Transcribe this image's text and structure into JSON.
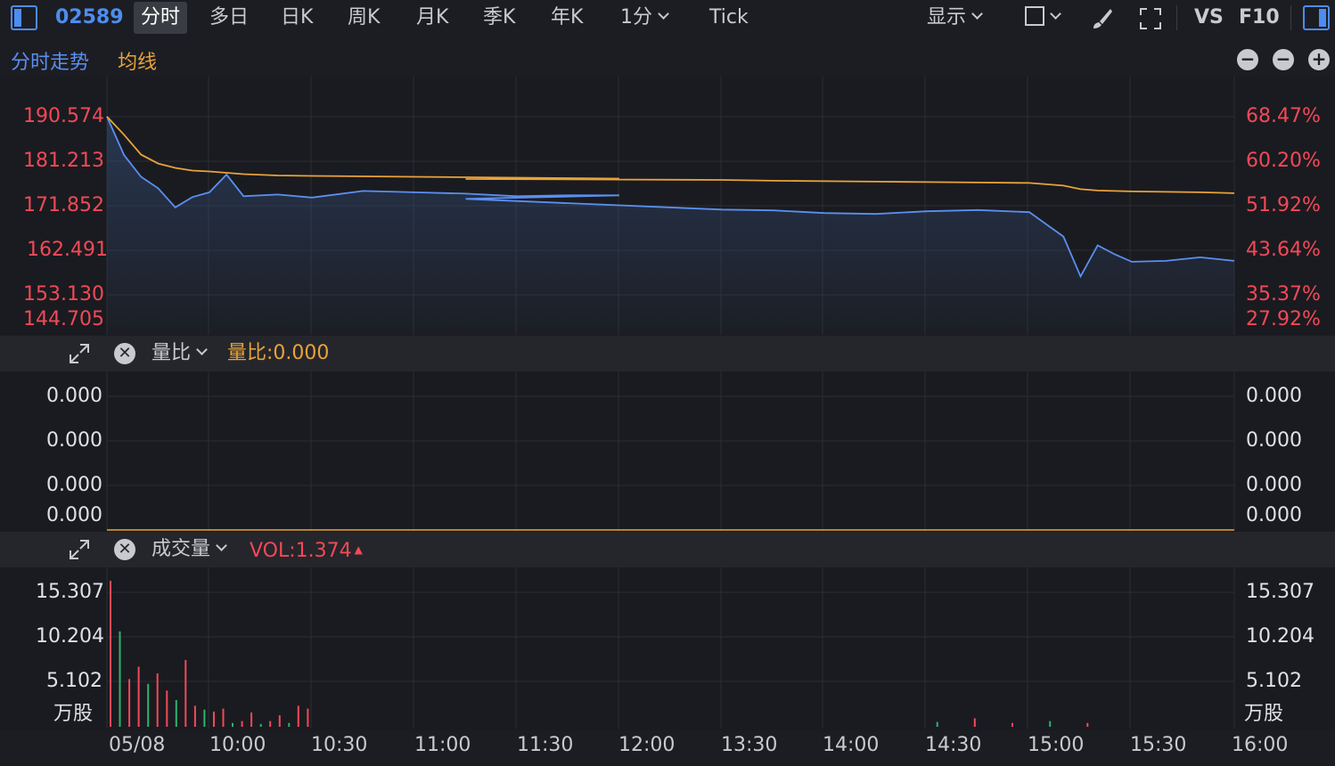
{
  "toolbar": {
    "code": "02589",
    "tabs": [
      "分时",
      "多日",
      "日K",
      "周K",
      "月K",
      "季K",
      "年K"
    ],
    "period": "1分",
    "tick": "Tick",
    "display": "显示",
    "vs": "VS",
    "f10": "F10"
  },
  "legend": {
    "series1": "分时走势",
    "series2": "均线",
    "color_price": "#5b8ff0",
    "color_avg": "#e8a33a"
  },
  "price_panel": {
    "left_labels": [
      "190.574",
      "181.213",
      "171.852",
      "162.491",
      "153.130",
      "144.705"
    ],
    "right_labels": [
      "68.47%",
      "60.20%",
      "51.92%",
      "43.64%",
      "35.37%",
      "27.92%"
    ],
    "up_color": "#f24957"
  },
  "ratio_panel": {
    "title": "量比",
    "value_text": "量比:0.000",
    "left_labels": [
      "0.000",
      "0.000",
      "0.000",
      "0.000"
    ],
    "right_labels": [
      "0.000",
      "0.000",
      "0.000",
      "0.000"
    ]
  },
  "volume_panel": {
    "title": "成交量",
    "value_text": "VOL:1.374",
    "left_labels": [
      "15.307",
      "10.204",
      "5.102",
      "万股"
    ],
    "right_labels": [
      "15.307",
      "10.204",
      "5.102",
      "万股"
    ]
  },
  "x_labels": [
    "05/08",
    "10:00",
    "10:30",
    "11:00",
    "11:30",
    "12:00",
    "13:30",
    "14:00",
    "14:30",
    "15:00",
    "15:30",
    "16:00"
  ],
  "chart_data": {
    "type": "line",
    "x": [
      "09:30",
      "09:35",
      "09:40",
      "09:45",
      "09:50",
      "09:55",
      "10:00",
      "10:05",
      "10:10",
      "10:20",
      "10:30",
      "10:45",
      "11:00",
      "11:15",
      "11:30",
      "11:45",
      "12:00",
      "12:15",
      "13:30",
      "13:45",
      "14:00",
      "14:15",
      "14:30",
      "14:45",
      "15:00",
      "15:10",
      "15:15",
      "15:20",
      "15:25",
      "15:30",
      "15:40",
      "15:50",
      "16:00"
    ],
    "series": [
      {
        "name": "分时走势",
        "values": [
          190.6,
          181.9,
          177.0,
          174.4,
          170.1,
          172.4,
          173.5,
          177.5,
          172.6,
          173.0,
          172.3,
          173.8,
          173.5,
          173.2,
          172.6,
          172.8,
          172.8,
          172.0,
          169.6,
          169.4,
          168.8,
          168.6,
          169.2,
          169.5,
          169.0,
          163.5,
          154.5,
          161.5,
          159.5,
          157.8,
          158.0,
          158.8,
          158.0
        ]
      },
      {
        "name": "均线",
        "values": [
          190.6,
          186.5,
          182.0,
          180.0,
          179.0,
          178.4,
          178.2,
          177.9,
          177.6,
          177.3,
          177.2,
          177.1,
          177.0,
          176.9,
          176.8,
          176.7,
          176.6,
          176.5,
          176.3,
          176.1,
          176.0,
          175.9,
          175.8,
          175.7,
          175.6,
          175.0,
          174.2,
          173.9,
          173.8,
          173.7,
          173.6,
          173.5,
          173.3
        ]
      }
    ],
    "ylim": [
      144.705,
      190.574
    ],
    "volume": [
      15.3,
      10.0,
      5.0,
      6.3,
      4.5,
      5.6,
      3.8,
      2.8,
      7.0,
      2.2,
      1.8,
      1.6,
      1.9,
      0.4,
      0.6,
      1.5,
      0.3,
      0.6,
      1.2,
      0.4,
      2.2,
      1.9,
      0.5,
      0.9,
      0.4,
      0.6,
      0.4
    ],
    "volume_ylim": [
      0,
      15.307
    ]
  }
}
